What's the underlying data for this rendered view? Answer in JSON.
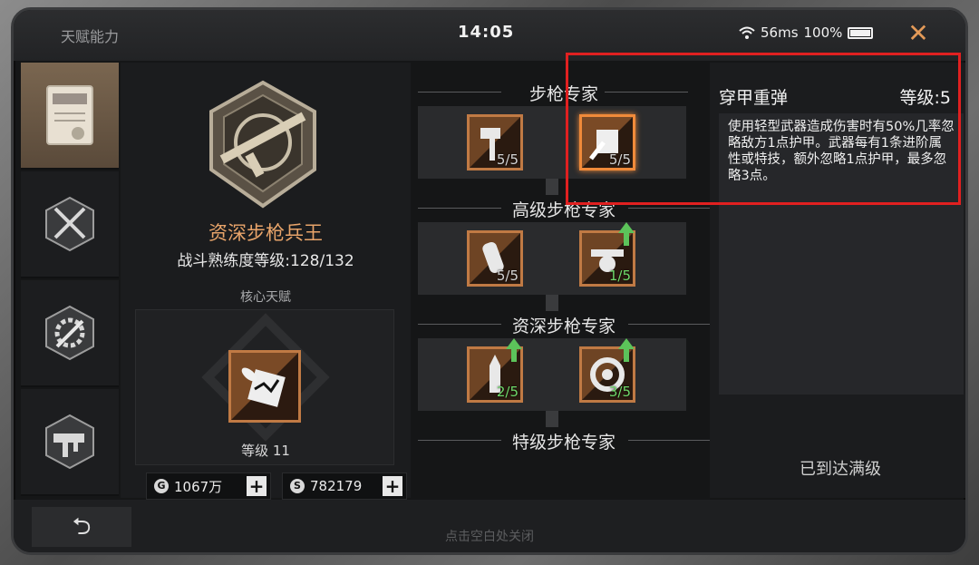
{
  "header": {
    "app_title": "天赋能力",
    "time": "14:05",
    "ping": "56ms",
    "battery": "100%"
  },
  "sidebar": {
    "tabs": [
      {
        "icon": "certificate-icon",
        "active": true
      },
      {
        "icon": "crossed-weapons-icon",
        "active": false
      },
      {
        "icon": "gear-hammer-icon",
        "active": false
      },
      {
        "icon": "submachine-gun-icon",
        "active": false
      }
    ]
  },
  "profile": {
    "rank_name": "资深步枪兵王",
    "mastery": "战斗熟练度等级:128/132",
    "core_label": "核心天赋",
    "core_level": "等级 11"
  },
  "currency": {
    "coins": "1067万",
    "silver": "782179"
  },
  "tree": {
    "tiers": [
      {
        "title": "步枪专家",
        "skills": [
          {
            "level": "5/5",
            "upgradable": false,
            "selected": false
          },
          {
            "level": "5/5",
            "upgradable": false,
            "selected": true
          }
        ]
      },
      {
        "title": "高级步枪专家",
        "skills": [
          {
            "level": "5/5",
            "upgradable": false,
            "selected": false
          },
          {
            "level": "1/5",
            "upgradable": true,
            "selected": false
          }
        ]
      },
      {
        "title": "资深步枪专家",
        "skills": [
          {
            "level": "2/5",
            "upgradable": true,
            "selected": false
          },
          {
            "level": "3/5",
            "upgradable": true,
            "selected": false
          }
        ]
      },
      {
        "title": "特级步枪专家",
        "skills": []
      }
    ]
  },
  "detail": {
    "name": "穿甲重弹",
    "level": "等级:5",
    "description": "使用轻型武器造成伤害时有50%几率忽略敌方1点护甲。武器每有1条进阶属性或特技，额外忽略1点护甲，最多忽略3点。",
    "status": "已到达满级"
  },
  "footer": {
    "back_symbol": "⮌",
    "hint": "点击空白处关闭"
  },
  "colors": {
    "accent_orange": "#e8a46a",
    "highlight_red": "#e02020",
    "upgrade_green": "#5cc35a"
  }
}
